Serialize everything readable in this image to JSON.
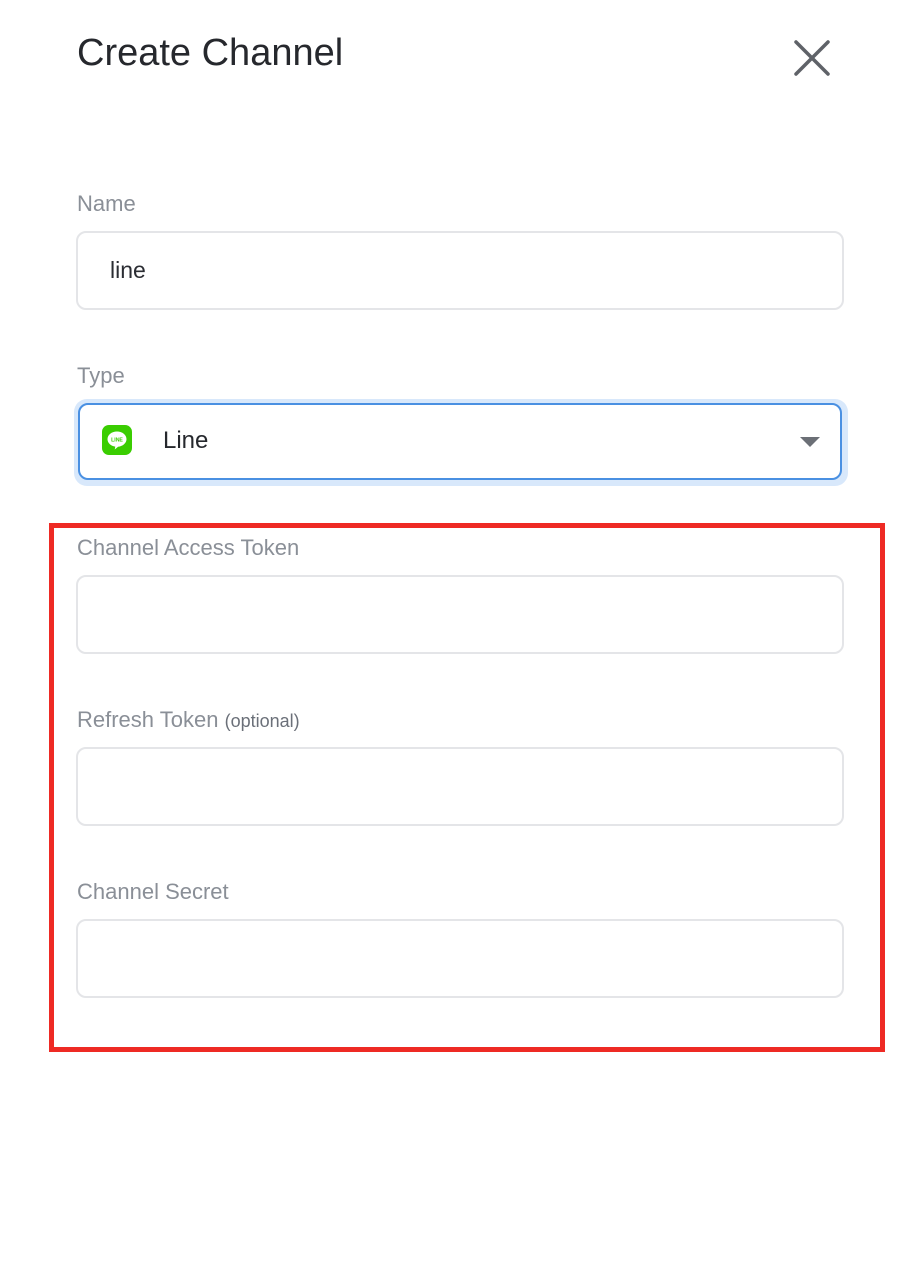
{
  "dialog": {
    "title": "Create Channel",
    "close_icon": "close-icon"
  },
  "form": {
    "name": {
      "label": "Name",
      "value": "line"
    },
    "type": {
      "label": "Type",
      "selected": "Line",
      "icon": "line-app-icon",
      "icon_text": "LINE",
      "icon_color": "#3acd01"
    },
    "channel_access_token": {
      "label": "Channel Access Token",
      "value": ""
    },
    "refresh_token": {
      "label": "Refresh Token",
      "optional_text": "(optional)",
      "value": ""
    },
    "channel_secret": {
      "label": "Channel Secret",
      "value": ""
    }
  },
  "annotation": {
    "highlight_color": "#ee2a24"
  }
}
